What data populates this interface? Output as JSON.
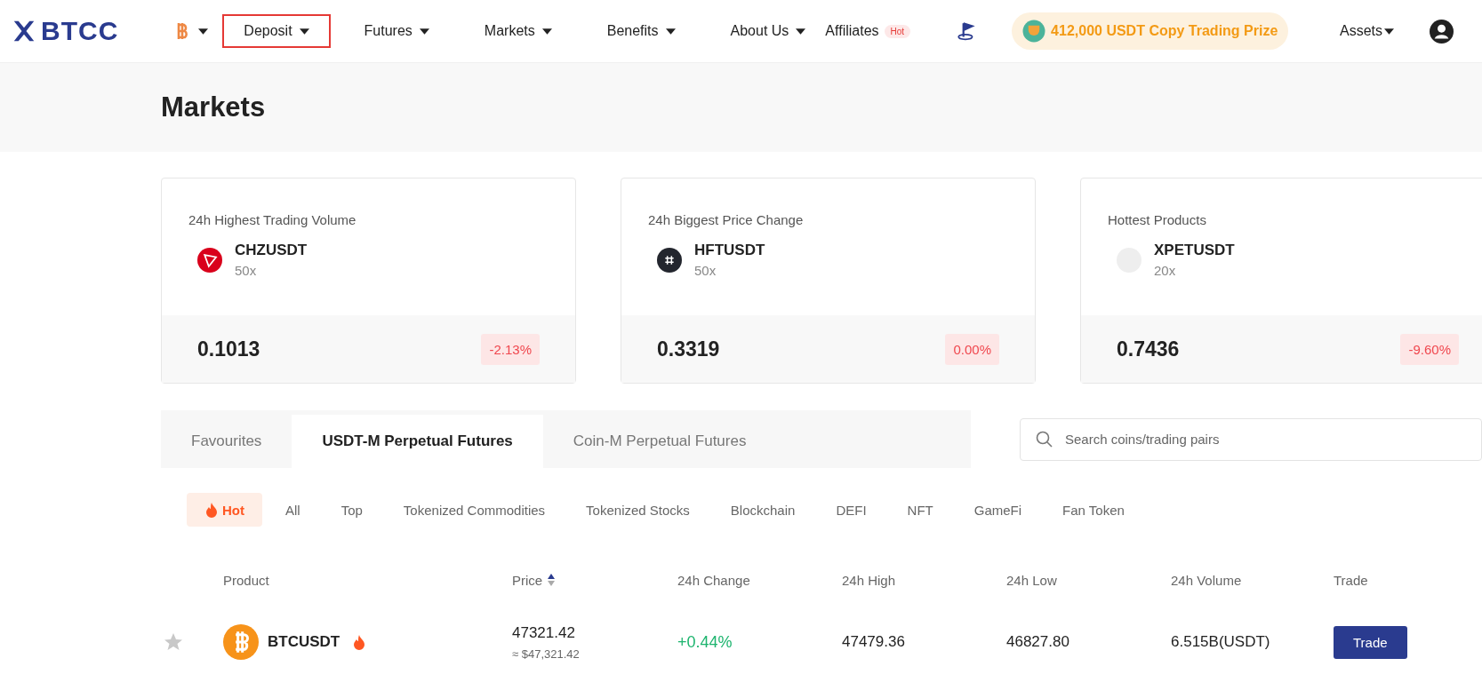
{
  "header": {
    "logo": "BTCC",
    "nav": [
      {
        "label": "Deposit",
        "highlighted": true,
        "dropdown": true
      },
      {
        "label": "Futures",
        "highlighted": false,
        "dropdown": true
      },
      {
        "label": "Markets",
        "highlighted": false,
        "dropdown": true
      },
      {
        "label": "Benefits",
        "highlighted": false,
        "dropdown": true
      },
      {
        "label": "About Us",
        "highlighted": false,
        "dropdown": true
      },
      {
        "label": "Affiliates",
        "highlighted": false,
        "dropdown": false,
        "badge": "Hot"
      }
    ],
    "promo": "412,000 USDT Copy Trading Prize",
    "assets": "Assets"
  },
  "page_title": "Markets",
  "cards": [
    {
      "title": "24h Highest Trading Volume",
      "symbol": "CHZUSDT",
      "leverage": "50x",
      "kind": "chz",
      "price": "0.1013",
      "change": "-2.13%"
    },
    {
      "title": "24h Biggest Price Change",
      "symbol": "HFTUSDT",
      "leverage": "50x",
      "kind": "hft",
      "price": "0.3319",
      "change": "0.00%"
    },
    {
      "title": "Hottest Products",
      "symbol": "XPETUSDT",
      "leverage": "20x",
      "kind": "blank",
      "price": "0.7436",
      "change": "-9.60%"
    }
  ],
  "tabs": [
    {
      "label": "Favourites",
      "selected": false
    },
    {
      "label": "USDT-M Perpetual Futures",
      "selected": true
    },
    {
      "label": "Coin-M Perpetual Futures",
      "selected": false
    }
  ],
  "search": {
    "placeholder": "Search coins/trading pairs"
  },
  "filters": [
    {
      "label": "Hot",
      "selected": true
    },
    {
      "label": "All",
      "selected": false
    },
    {
      "label": "Top",
      "selected": false
    },
    {
      "label": "Tokenized Commodities",
      "selected": false
    },
    {
      "label": "Tokenized Stocks",
      "selected": false
    },
    {
      "label": "Blockchain",
      "selected": false
    },
    {
      "label": "DEFI",
      "selected": false
    },
    {
      "label": "NFT",
      "selected": false
    },
    {
      "label": "GameFi",
      "selected": false
    },
    {
      "label": "Fan Token",
      "selected": false
    }
  ],
  "table": {
    "columns": [
      "Product",
      "Price",
      "24h Change",
      "24h High",
      "24h Low",
      "24h Volume",
      "Trade"
    ],
    "rows": [
      {
        "favourite": false,
        "hot": true,
        "symbol": "BTCUSDT",
        "price": "47321.42",
        "price_usd": "≈ $47,321.42",
        "change": "+0.44%",
        "high": "47479.36",
        "low": "46827.80",
        "volume": "6.515B(USDT)",
        "action": "Trade"
      }
    ]
  }
}
